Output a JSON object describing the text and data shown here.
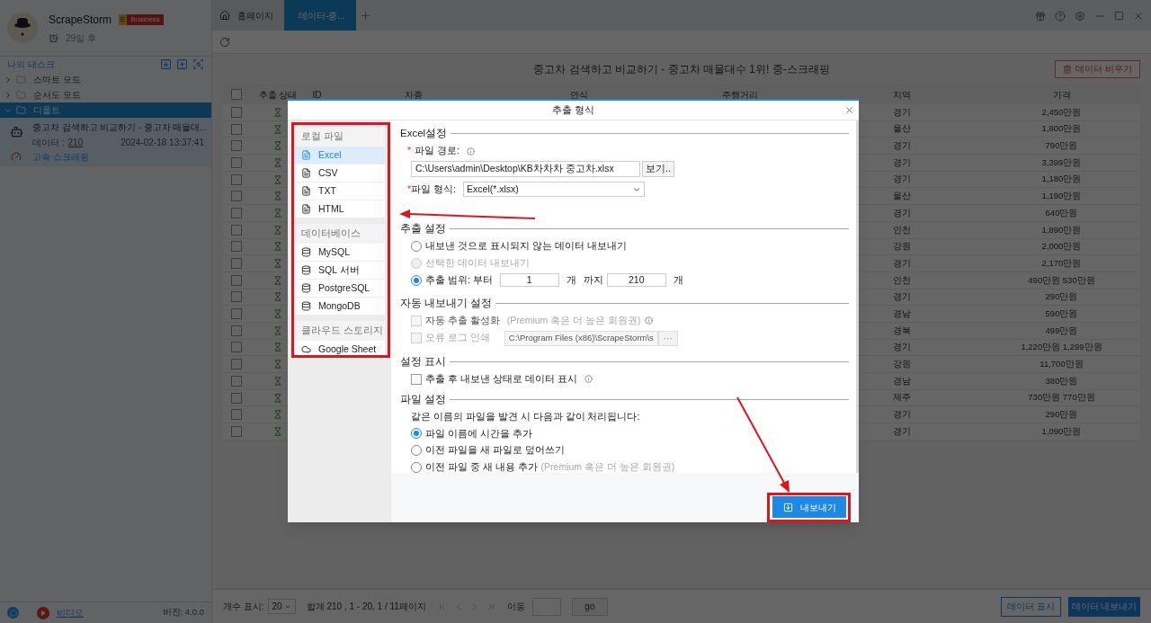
{
  "sidebar": {
    "user": {
      "name": "ScrapeStorm",
      "plan_letter": "E",
      "plan": "Business",
      "expiry": "29일 후"
    },
    "tasks_title": "나의 태스크",
    "tree": [
      {
        "label": "스마트 모드",
        "expanded": false,
        "selected": false
      },
      {
        "label": "순서도 모드",
        "expanded": false,
        "selected": false
      },
      {
        "label": "디폴트",
        "expanded": true,
        "selected": true,
        "children": [
          {
            "title": "중고차 검색하고 비교하기 - 중고차 매물대...",
            "data_label": "데이터 :",
            "data_count": "210",
            "date": "2024-02-18 13:37:41",
            "mode": "고속 스크래핑"
          }
        ]
      }
    ],
    "footer": {
      "video": "비디오",
      "version": "버전: 4.0.0"
    }
  },
  "tabs": [
    {
      "label": "홈페이지",
      "selected": false,
      "kind": "home"
    },
    {
      "label": "데이터-중...",
      "selected": true,
      "kind": "data"
    }
  ],
  "page": {
    "title": "중고차 검색하고 비교하기 - 중고차 매물대수 1위! 중-스크래핑",
    "clear_button": "데이터 비우기"
  },
  "table": {
    "columns": [
      "추출 상태",
      "ID",
      "차종",
      "연식",
      "주행거리",
      "지역",
      "가격"
    ],
    "select_all_checked": false,
    "rows": [
      {
        "checked": false,
        "region": "경기",
        "price": "2,450만원"
      },
      {
        "checked": false,
        "region": "울산",
        "price": "1,800만원"
      },
      {
        "checked": false,
        "region": "경기",
        "price": "790만원"
      },
      {
        "checked": false,
        "region": "경기",
        "price": "3,399만원"
      },
      {
        "checked": false,
        "region": "경기",
        "price": "1,180만원"
      },
      {
        "checked": false,
        "region": "울산",
        "price": "1,190만원"
      },
      {
        "checked": false,
        "region": "경기",
        "price": "640만원"
      },
      {
        "checked": false,
        "region": "인천",
        "price": "1,890만원"
      },
      {
        "checked": false,
        "region": "강원",
        "price": "2,000만원"
      },
      {
        "checked": false,
        "region": "경기",
        "price": "2,170만원"
      },
      {
        "checked": false,
        "region": "인천",
        "price": "490만원 530만원"
      },
      {
        "checked": false,
        "region": "경기",
        "price": "290만원"
      },
      {
        "checked": false,
        "region": "경남",
        "price": "590만원"
      },
      {
        "checked": false,
        "region": "경북",
        "price": "499만원"
      },
      {
        "checked": false,
        "region": "경기",
        "price": "1,220만원 1,299만원"
      },
      {
        "checked": false,
        "region": "강원",
        "price": "11,700만원"
      },
      {
        "checked": false,
        "region": "경남",
        "price": "380만원"
      },
      {
        "checked": false,
        "region": "제주",
        "price": "730만원 770만원"
      },
      {
        "checked": false,
        "region": "경기",
        "price": "290만원"
      },
      {
        "checked": false,
        "region": "경기",
        "price": "1,090만원"
      }
    ]
  },
  "pager": {
    "page_size_label": "개수 표시:",
    "page_size": "20",
    "summary": "합계 210 , 1 - 20, 1 / 11페이지",
    "goto_label": "이동",
    "go_button": "go",
    "show_button": "데이터 표시",
    "export_button": "데이터 내보내기"
  },
  "dialog": {
    "title": "추출 형식",
    "menu": [
      {
        "group": "로컬 파일",
        "items": [
          {
            "label": "Excel",
            "kind": "file",
            "selected": true
          },
          {
            "label": "CSV",
            "kind": "file",
            "selected": false
          },
          {
            "label": "TXT",
            "kind": "file",
            "selected": false
          },
          {
            "label": "HTML",
            "kind": "file",
            "selected": false
          }
        ]
      },
      {
        "group": "데이터베이스",
        "items": [
          {
            "label": "MySQL",
            "kind": "database",
            "selected": false
          },
          {
            "label": "SQL 서버",
            "kind": "database",
            "selected": false
          },
          {
            "label": "PostgreSQL",
            "kind": "database",
            "selected": false
          },
          {
            "label": "MongoDB",
            "kind": "database",
            "selected": false
          }
        ]
      },
      {
        "group": "클라우드 스토리지",
        "items": [
          {
            "label": "Google Sheet",
            "kind": "cloud",
            "selected": false
          }
        ]
      }
    ],
    "excel": {
      "heading": "Excel설정",
      "path_mark": "*",
      "format_mark": "*",
      "path_label": "파일 경로:",
      "path_value": "C:\\Users\\admin\\Desktop\\KB차차차 중고차.xlsx",
      "browse_button": "보기..",
      "format_label": "파일 형식:",
      "format_value": "Excel(*.xlsx)"
    },
    "extract": {
      "heading": "추출 설정",
      "options": [
        {
          "label": "내보낸 것으로 표시되지 않는 데이터 내보내기",
          "selected": false,
          "disabled": false,
          "kind": "plain"
        },
        {
          "label": "선택한 데이터 내보내기",
          "selected": false,
          "disabled": true,
          "kind": "plain"
        },
        {
          "label": "추출 범위: 부터",
          "selected": true,
          "disabled": false,
          "kind": "range"
        }
      ],
      "range_from": "1",
      "unit_1": "개",
      "to_label": "까지",
      "range_to": "210",
      "unit_2": "개"
    },
    "auto": {
      "heading": "자동 내보내기 설정",
      "enable": {
        "label": "자동 추출 활성화",
        "note": "(Premium 혹은 더 높은 회원권)",
        "checked": false,
        "disabled": true
      },
      "log": {
        "label": "오류 로그 인쇄",
        "checked": false,
        "disabled": true,
        "path": "C:\\Program Files (x86)\\ScrapeStorm\\s",
        "browse": "···"
      }
    },
    "display": {
      "heading": "설정 표시",
      "option": {
        "label": "추출 후 내보낸 상태로 데이터 표시",
        "checked": false
      }
    },
    "file": {
      "heading": "파일 설정",
      "intro": "같은 이름의 파일을 발견 시 다음과 같이 처리됩니다:",
      "options": [
        {
          "label": "파일 이름에 시간을 추가",
          "selected": true
        },
        {
          "label": "이전 파일을 새 파일로 덮어쓰기",
          "selected": false
        },
        {
          "label": "이전 파일 중 새 내용 추가",
          "note": "(Premium 혹은 더 높은 회원권)",
          "selected": false
        }
      ]
    },
    "export_button": "내보내기"
  }
}
